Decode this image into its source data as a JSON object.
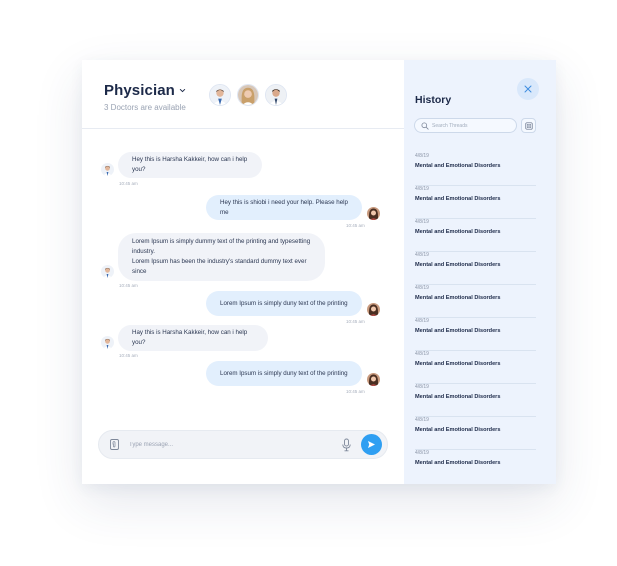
{
  "header": {
    "title": "Physician",
    "subtitle": "3 Doctors are available"
  },
  "messages": [
    {
      "direction": "in",
      "text": "Hey this is Harsha Kakkeir, how can i help you?",
      "time": "10:45 am"
    },
    {
      "direction": "out",
      "text": "Hey this is shiobi i need your help. Please help me",
      "time": "10:45 am"
    },
    {
      "direction": "in",
      "text": "Lorem Ipsum is simply dummy text of the printing and typesetting industry.\nLorem Ipsum has been the industry's standard dummy text ever since",
      "time": "10:45 am"
    },
    {
      "direction": "out",
      "text": "Lorem Ipsum is simply duny text of the printing",
      "time": "10:45 am"
    },
    {
      "direction": "in",
      "text": "Hay this is Harsha Kakkeir, how can i help you?",
      "time": "10:45 am"
    },
    {
      "direction": "out",
      "text": "Lorem Ipsum is simply duny text of the printing",
      "time": "10:45 am"
    }
  ],
  "composer": {
    "placeholder": "Type message..."
  },
  "history": {
    "title": "History",
    "search_placeholder": "Search Threads",
    "threads": [
      {
        "date": "4/8/19",
        "title": "Mental and Emotional Disorders"
      },
      {
        "date": "4/8/19",
        "title": "Mental and Emotional Disorders"
      },
      {
        "date": "4/8/19",
        "title": "Mental and Emotional Disorders"
      },
      {
        "date": "4/8/19",
        "title": "Mental and Emotional Disorders"
      },
      {
        "date": "4/8/19",
        "title": "Mental and Emotional Disorders"
      },
      {
        "date": "4/8/19",
        "title": "Mental and Emotional Disorders"
      },
      {
        "date": "4/8/19",
        "title": "Mental and Emotional Disorders"
      },
      {
        "date": "4/8/19",
        "title": "Mental and Emotional Disorders"
      },
      {
        "date": "4/8/19",
        "title": "Mental and Emotional Disorders"
      },
      {
        "date": "4/8/19",
        "title": "Mental and Emotional Disorders"
      }
    ]
  },
  "colors": {
    "accent": "#2f9ff2",
    "incoming_bubble": "#f1f3f8",
    "outgoing_bubble": "#e2effd",
    "history_bg": "#edf3fd"
  },
  "icons": [
    "chevron-down-icon",
    "attachment-icon",
    "microphone-icon",
    "send-icon",
    "close-icon",
    "search-icon",
    "filter-icon"
  ]
}
